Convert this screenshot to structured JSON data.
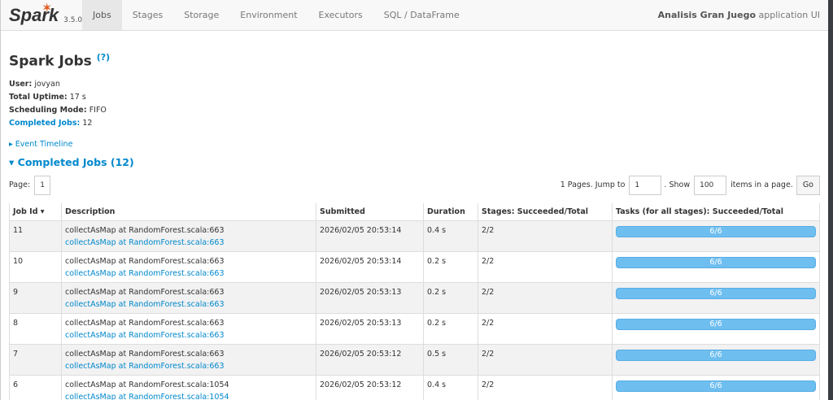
{
  "nav": {
    "logo": "Spark",
    "version": "3.5.0",
    "tabs": [
      "Jobs",
      "Stages",
      "Storage",
      "Environment",
      "Executors",
      "SQL / DataFrame"
    ],
    "app_name": "Analisis Gran Juego",
    "app_suffix": "application UI"
  },
  "page": {
    "title": "Spark Jobs",
    "help": "(?)",
    "user_label": "User:",
    "user": "jovyan",
    "uptime_label": "Total Uptime:",
    "uptime": "17 s",
    "sched_label": "Scheduling Mode:",
    "sched": "FIFO",
    "completed_label": "Completed Jobs:",
    "completed": "12",
    "event_timeline": "Event Timeline",
    "completed_header": "Completed Jobs (12)"
  },
  "pager": {
    "page_label": "Page:",
    "page": "1",
    "pages_text": "1 Pages. Jump to",
    "jump": "1",
    "show_label": ". Show",
    "show": "100",
    "items_text": "items in a page.",
    "go": "Go"
  },
  "table": {
    "headers": [
      "Job Id ▾",
      "Description",
      "Submitted",
      "Duration",
      "Stages: Succeeded/Total",
      "Tasks (for all stages): Succeeded/Total"
    ],
    "rows": [
      {
        "id": "11",
        "desc": "collectAsMap at RandomForest.scala:663",
        "link": "collectAsMap at RandomForest.scala:663",
        "submitted": "2026/02/05 20:53:14",
        "duration": "0.4 s",
        "stages": "2/2",
        "tasks": "6/6",
        "progress": 1
      },
      {
        "id": "10",
        "desc": "collectAsMap at RandomForest.scala:663",
        "link": "collectAsMap at RandomForest.scala:663",
        "submitted": "2026/02/05 20:53:14",
        "duration": "0.2 s",
        "stages": "2/2",
        "tasks": "6/6",
        "progress": 1
      },
      {
        "id": "9",
        "desc": "collectAsMap at RandomForest.scala:663",
        "link": "collectAsMap at RandomForest.scala:663",
        "submitted": "2026/02/05 20:53:13",
        "duration": "0.2 s",
        "stages": "2/2",
        "tasks": "6/6",
        "progress": 1
      },
      {
        "id": "8",
        "desc": "collectAsMap at RandomForest.scala:663",
        "link": "collectAsMap at RandomForest.scala:663",
        "submitted": "2026/02/05 20:53:13",
        "duration": "0.2 s",
        "stages": "2/2",
        "tasks": "6/6",
        "progress": 1
      },
      {
        "id": "7",
        "desc": "collectAsMap at RandomForest.scala:663",
        "link": "collectAsMap at RandomForest.scala:663",
        "submitted": "2026/02/05 20:53:12",
        "duration": "0.5 s",
        "stages": "2/2",
        "tasks": "6/6",
        "progress": 1
      },
      {
        "id": "6",
        "desc": "collectAsMap at RandomForest.scala:1054",
        "link": "collectAsMap at RandomForest.scala:1054",
        "submitted": "2026/02/05 20:53:12",
        "duration": "0.4 s",
        "stages": "2/2",
        "tasks": "6/6",
        "progress": 1
      }
    ]
  }
}
